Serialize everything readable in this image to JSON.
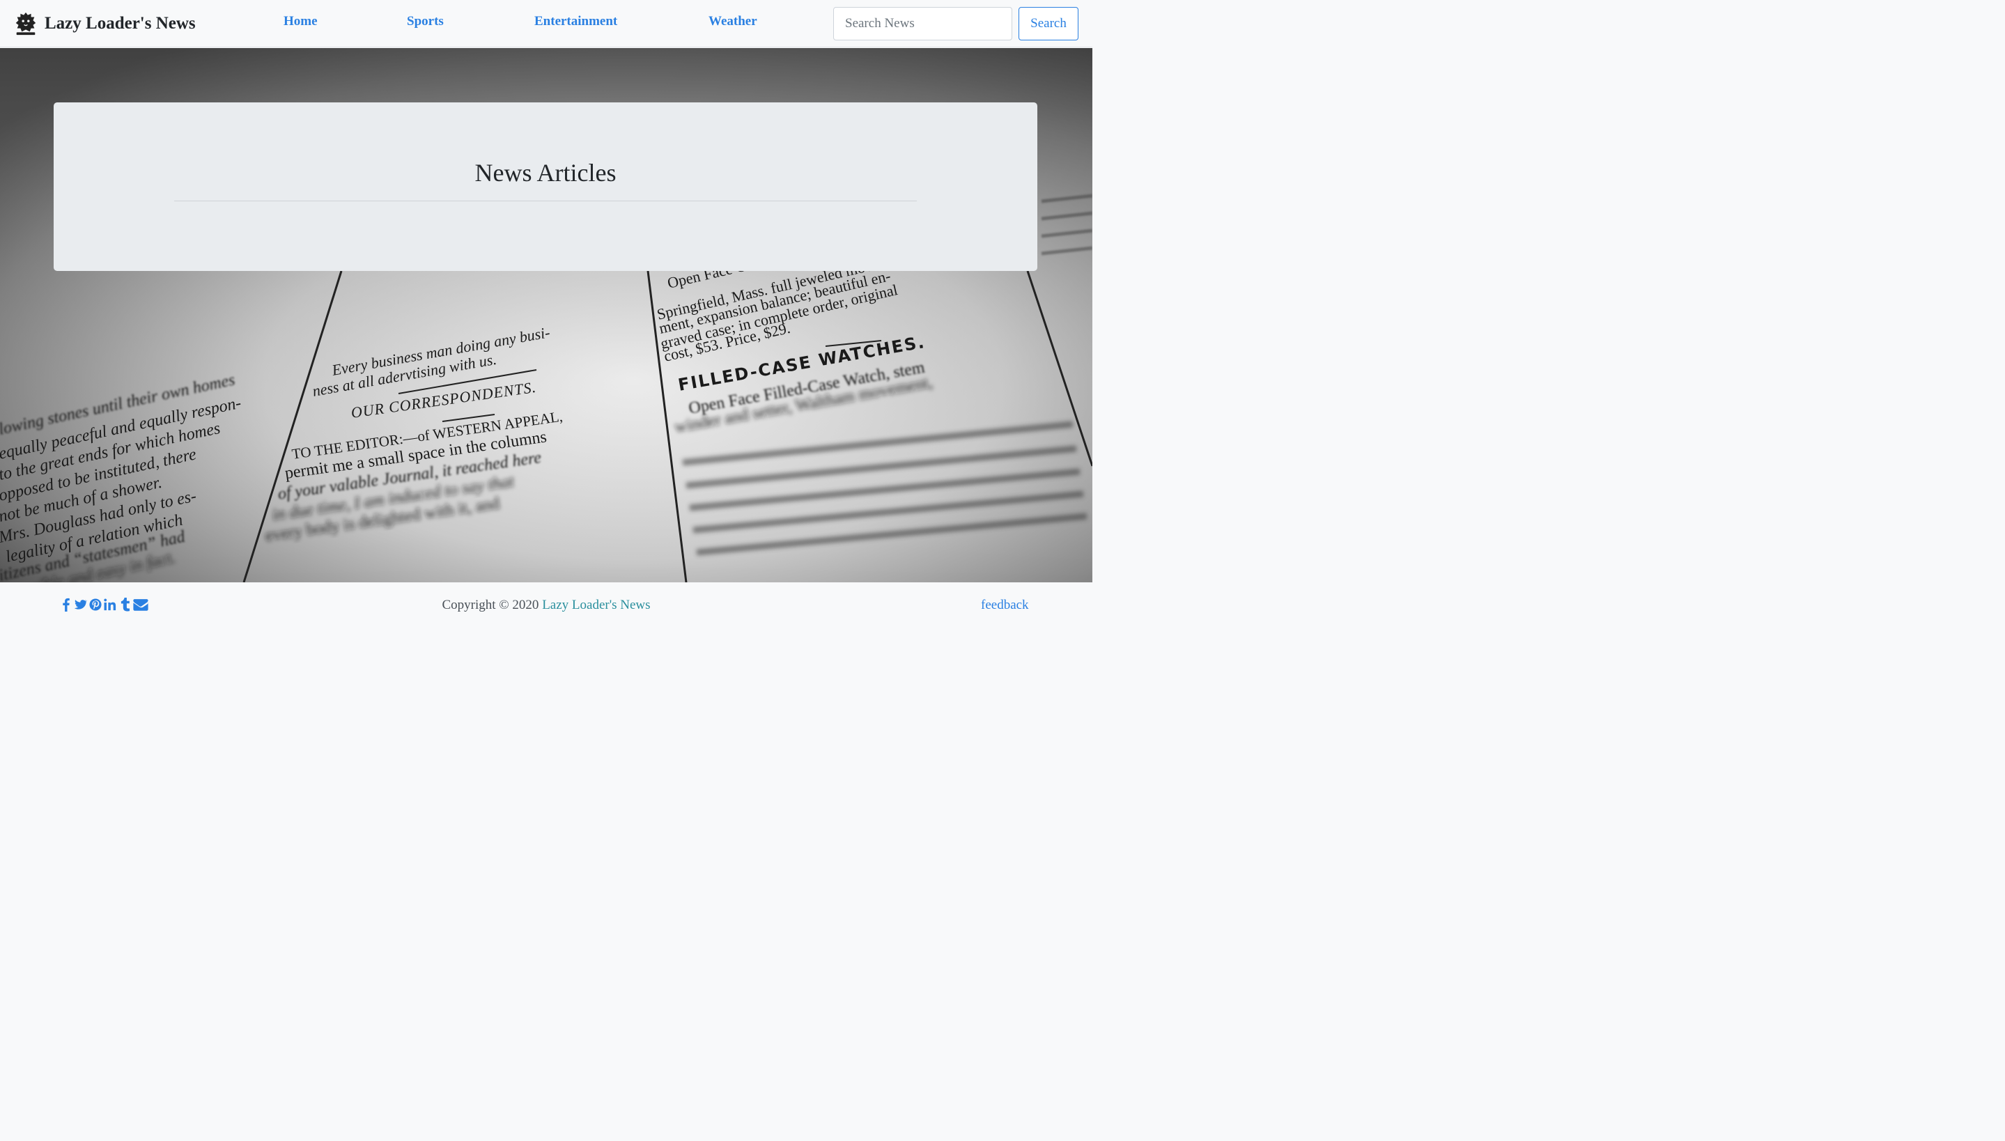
{
  "brand": {
    "name": "Lazy Loader's News",
    "logo_icon": "lion-crest-icon"
  },
  "nav": {
    "items": [
      {
        "label": "Home"
      },
      {
        "label": "Sports"
      },
      {
        "label": "Entertainment"
      },
      {
        "label": "Weather"
      }
    ]
  },
  "search": {
    "placeholder": "Search News",
    "value": "",
    "button_label": "Search"
  },
  "hero": {
    "title": "News Articles",
    "background_icon": "newspaper-photo",
    "newspaper_text": {
      "left_column": [
        "lowing stones until their own homes",
        "equally peaceful and equally respon-",
        "to the great ends for which homes",
        "opposed to be instituted, there",
        "not be much of a shower.",
        "Mrs. Douglass had only to es-",
        "legality of a relation which",
        "itizens and “statesmen” had",
        "e possible and easy in fact."
      ],
      "middle_column": [
        "Every business man doing any busi-",
        "ness at all adervtising with us.",
        "OUR CORRESPONDENTS.",
        "TO THE EDITOR:—of WESTERN APPEAL,",
        "permit me a small space in the columns",
        "of your valable Journal, it reached here",
        "in due time, I am induced to say that",
        "every body is delighted with it, and"
      ],
      "right_column": [
        "Open Face Gold Watch, key",
        "Springfield, Mass. full jeweled move-",
        "ment, expansion balance; beautiful en-",
        "graved case; in complete order, original",
        "cost, $53.   Price, $29.",
        "FILLED-CASE WATCHES.",
        "Open Face Filled-Case Watch, stem",
        "winder and setter, Waltham movement,"
      ]
    }
  },
  "footer": {
    "social_icons": [
      "facebook-icon",
      "twitter-icon",
      "pinterest-icon",
      "linkedin-icon",
      "tumblr-icon",
      "envelope-icon"
    ],
    "copyright_prefix": "Copyright © 2020",
    "copyright_link": "Lazy Loader's News",
    "feedback_label": "feedback"
  },
  "colors": {
    "accent": "#2a80e2",
    "copyright_link": "#2a8f9d",
    "navbar_bg": "#f8f9fa",
    "jumbotron_bg": "#e9ecef"
  }
}
